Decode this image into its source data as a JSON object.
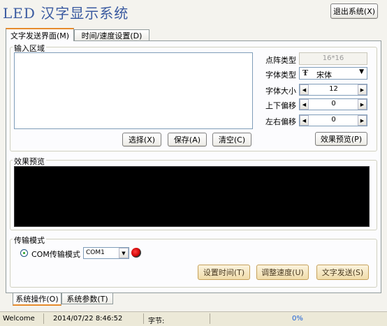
{
  "app": {
    "title": "LED 汉字显示系统",
    "exit_button": "退出系统(X)"
  },
  "top_tabs": [
    {
      "label": "文字发送界面(M)",
      "active": true
    },
    {
      "label": "时间/速度设置(D)",
      "active": false
    }
  ],
  "input_area": {
    "label": "输入区域",
    "text": "",
    "buttons": {
      "select": "选择(X)",
      "save": "保存(A)",
      "clear": "清空(C)"
    }
  },
  "settings": {
    "dot_matrix_label": "点阵类型",
    "dot_matrix_value": "16*16",
    "font_label": "字体类型",
    "font_value": "宋体",
    "font_icon": "truetype-font-icon",
    "size_label": "字体大小",
    "size_value": "12",
    "vertical_offset_label": "上下偏移",
    "vertical_offset_value": "0",
    "horizontal_offset_label": "左右偏移",
    "horizontal_offset_value": "0",
    "preview_button": "效果预览(P)"
  },
  "preview": {
    "label": "效果预览",
    "screen_color": "#000000"
  },
  "transmission": {
    "label": "传输模式",
    "com_mode_label": "COM传输模式",
    "com_port": "COM1",
    "indicator_color": "#cc0000",
    "buttons": {
      "set_time": "设置时间(T)",
      "adjust_speed": "调整速度(U)",
      "send_text": "文字发送(S)"
    }
  },
  "bottom_tabs": [
    {
      "label": "系统操作(O)",
      "active": true
    },
    {
      "label": "系统参数(T)",
      "active": false
    }
  ],
  "status_bar": {
    "welcome": "Welcome",
    "datetime": "2014/07/22  8:46:52",
    "bytes_label": "字节:",
    "bytes_value": "",
    "progress": "0%"
  },
  "colors": {
    "accent_tab": "#e68b2c",
    "title": "#3a5aa0",
    "progress_text": "#1a5fd6"
  }
}
